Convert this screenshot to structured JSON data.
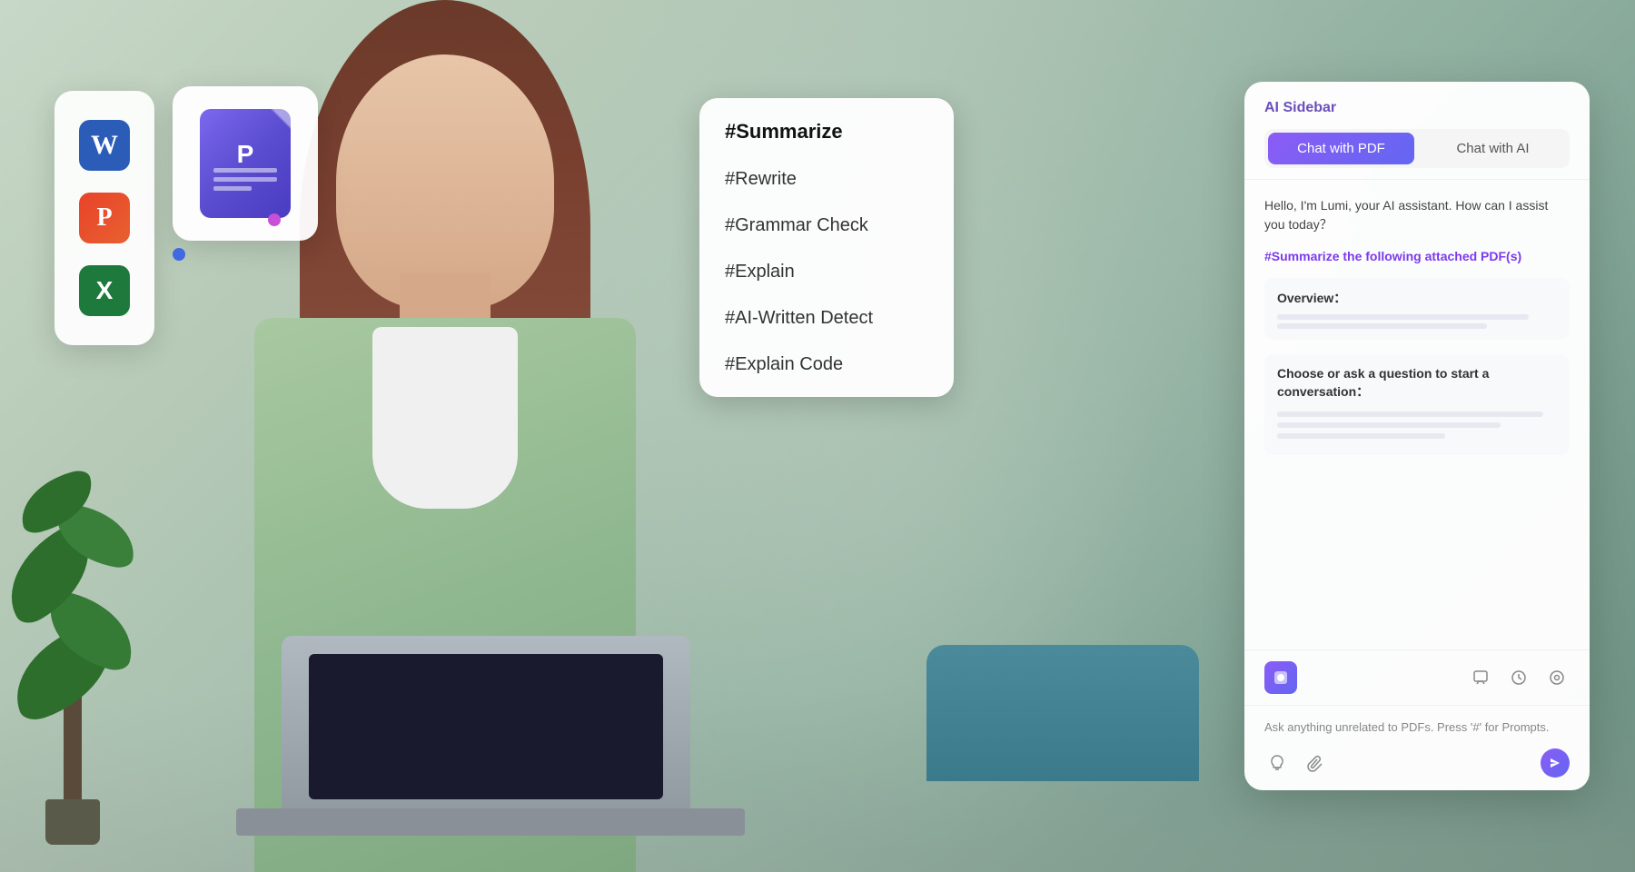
{
  "background": {
    "color": "#b8c8b8"
  },
  "app_icons_card": {
    "icons": [
      {
        "name": "Word",
        "letter": "W",
        "color_class": "app-icon-word"
      },
      {
        "name": "PowerPoint",
        "letter": "P",
        "color_class": "app-icon-ppt"
      },
      {
        "name": "Excel",
        "letter": "X",
        "color_class": "app-icon-excel"
      }
    ]
  },
  "pdf_card": {
    "icon_letter": "P"
  },
  "commands_card": {
    "items": [
      "#Summarize",
      "#Rewrite",
      "#Grammar Check",
      "#Explain",
      "#AI-Written Detect",
      "#Explain Code"
    ]
  },
  "ai_sidebar": {
    "title": "AI Sidebar",
    "tabs": [
      {
        "label": "Chat with PDF",
        "active": true
      },
      {
        "label": "Chat with AI",
        "active": false
      }
    ],
    "greeting": "Hello, I'm Lumi, your AI assistant. How can I assist you today？",
    "summarize_command": "#Summarize the following attached PDF(s)",
    "overview_label": "Overview：",
    "choose_label": "Choose or ask a question to start a conversation：",
    "toolbar": {
      "icons": [
        "chat",
        "clock",
        "settings"
      ]
    },
    "input_placeholder": "Ask anything unrelated to PDFs. Press '#' for Prompts.",
    "input_icons": [
      "lightbulb",
      "paperclip"
    ],
    "send_label": "send"
  }
}
